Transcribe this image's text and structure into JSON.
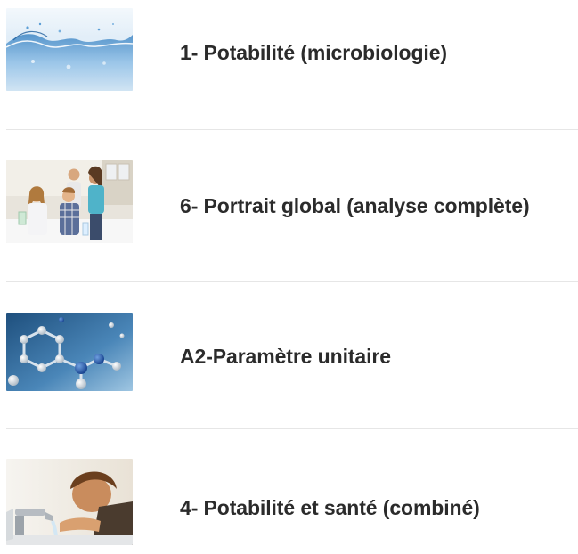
{
  "items": [
    {
      "title": "1- Potabilité (microbiologie)",
      "image": "water-splash-image"
    },
    {
      "title": "6- Portrait global (analyse complète)",
      "image": "family-kitchen-image"
    },
    {
      "title": "A2-Paramètre unitaire",
      "image": "molecules-image"
    },
    {
      "title": "4- Potabilité et santé (combiné)",
      "image": "child-drinking-tap-image"
    }
  ]
}
